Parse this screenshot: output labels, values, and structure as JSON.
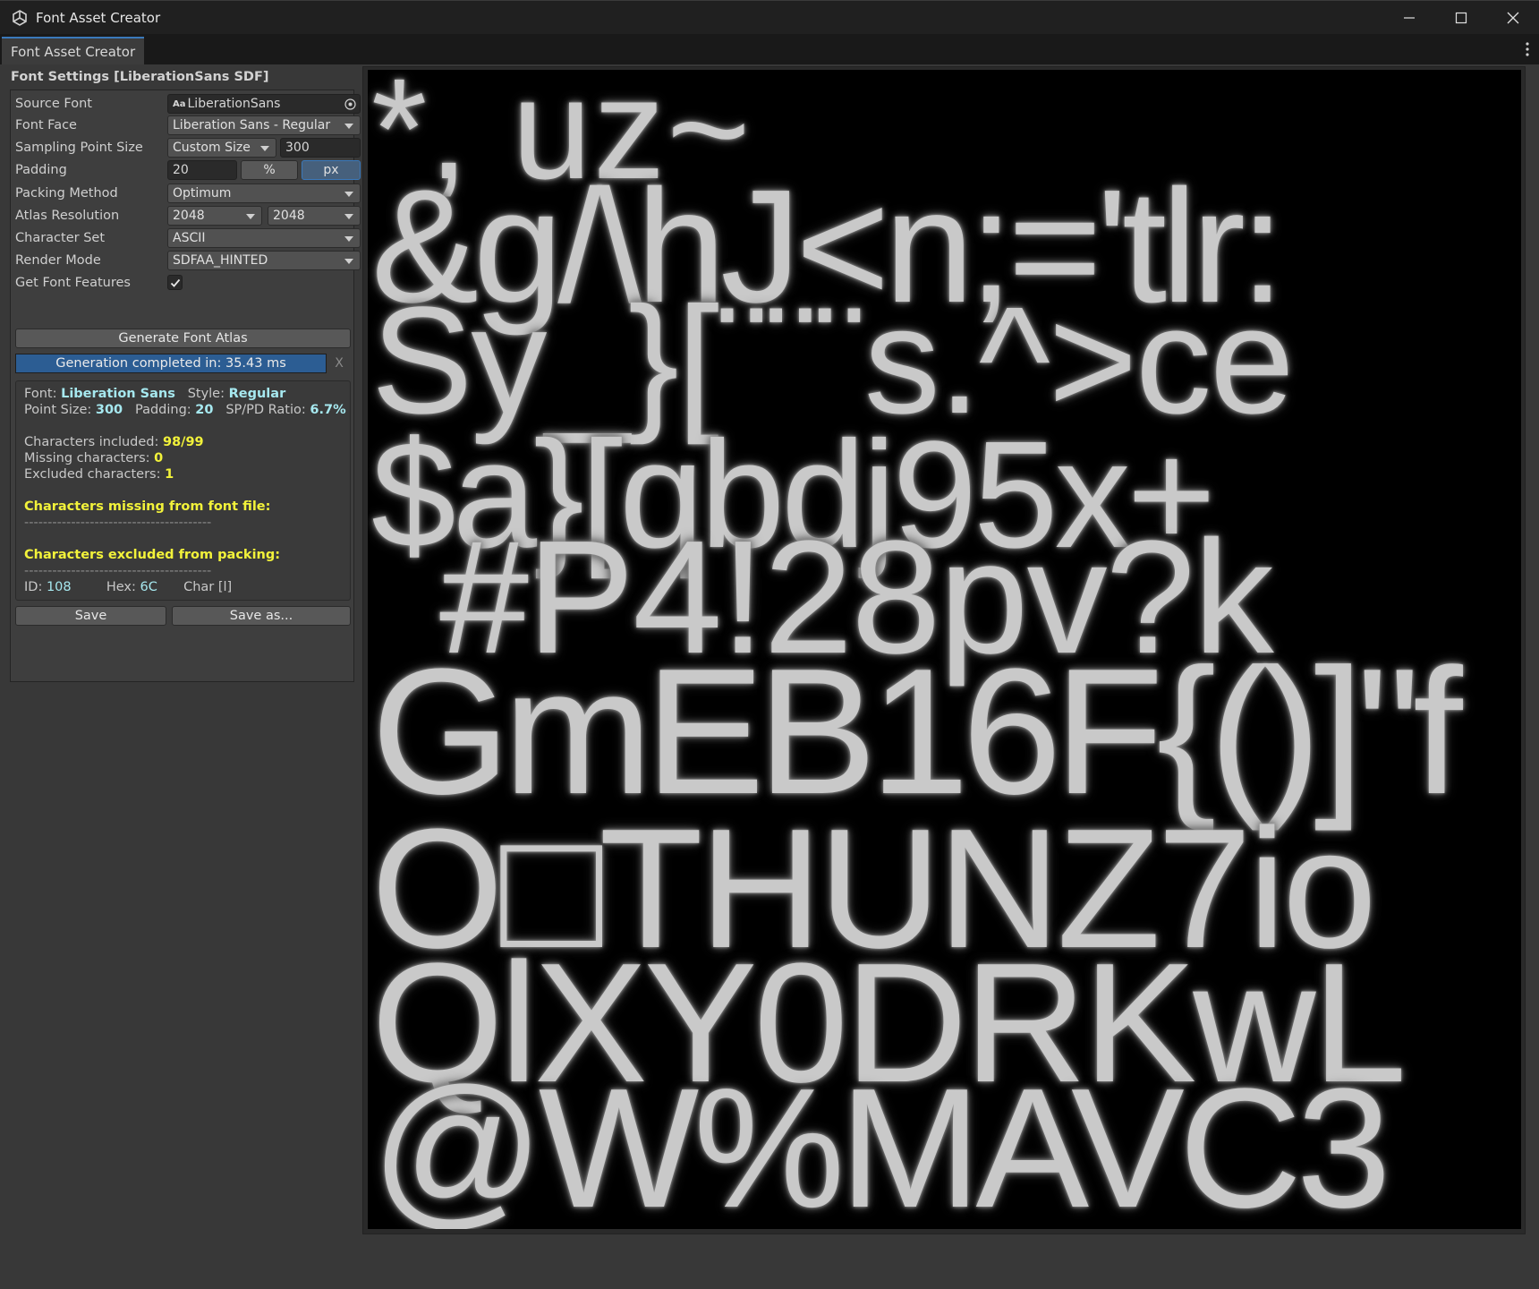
{
  "window": {
    "title": "Font Asset Creator",
    "controls": [
      "minimize-icon",
      "maximize-icon",
      "close-icon"
    ]
  },
  "tab": {
    "label": "Font Asset Creator"
  },
  "settings": {
    "section_title": "Font Settings [LiberationSans SDF]",
    "source_font": {
      "label": "Source Font",
      "value": "LiberationSans",
      "icon": "font-asset-icon"
    },
    "font_face": {
      "label": "Font Face",
      "value": "Liberation Sans - Regular"
    },
    "sampling_point_size": {
      "label": "Sampling Point Size",
      "mode": "Custom Size",
      "value": "300"
    },
    "padding": {
      "label": "Padding",
      "value": "20",
      "unit_percent": "%",
      "unit_px": "px",
      "selected_unit": "px"
    },
    "packing_method": {
      "label": "Packing Method",
      "value": "Optimum"
    },
    "atlas_resolution": {
      "label": "Atlas Resolution",
      "width": "2048",
      "height": "2048"
    },
    "character_set": {
      "label": "Character Set",
      "value": "ASCII"
    },
    "render_mode": {
      "label": "Render Mode",
      "value": "SDFAA_HINTED"
    },
    "get_font_features": {
      "label": "Get Font Features",
      "checked": true
    }
  },
  "actions": {
    "generate_label": "Generate Font Atlas",
    "progress_text": "Generation completed in: 35.43 ms",
    "progress_fraction": 1.0,
    "cancel_label": "X",
    "save_label": "Save",
    "save_as_label": "Save as..."
  },
  "info": {
    "font_label": "Font:",
    "font_value": "Liberation Sans",
    "style_label": "Style:",
    "style_value": "Regular",
    "point_size_label": "Point Size:",
    "point_size_value": "300",
    "padding_label": "Padding:",
    "padding_value": "20",
    "sppd_label": "SP/PD Ratio:",
    "sppd_value": "6.7%",
    "chars_included_label": "Characters included:",
    "chars_included_value": "98/99",
    "missing_label": "Missing characters:",
    "missing_value": "0",
    "excluded_label": "Excluded characters:",
    "excluded_value": "1",
    "missing_header": "Characters missing from font file:",
    "separator": "----------------------------------------",
    "excluded_header": "Characters excluded from packing:",
    "id_label": "ID:",
    "id_value": "108",
    "hex_label": "Hex:",
    "hex_value": "6C",
    "char_label": "Char [l]"
  },
  "atlas_rows": [
    "*,  uz~",
    "&g/\\hJ<n;='tlr:",
    "Sy_}[¨¨¨s.^>ce",
    "$a}[qbdj95x+",
    "#P4!28pv?k",
    "GmEB16F{()]\"f",
    "O□THUNZ7io",
    "QlXY0DRKwL",
    "@W%MAVC3"
  ]
}
